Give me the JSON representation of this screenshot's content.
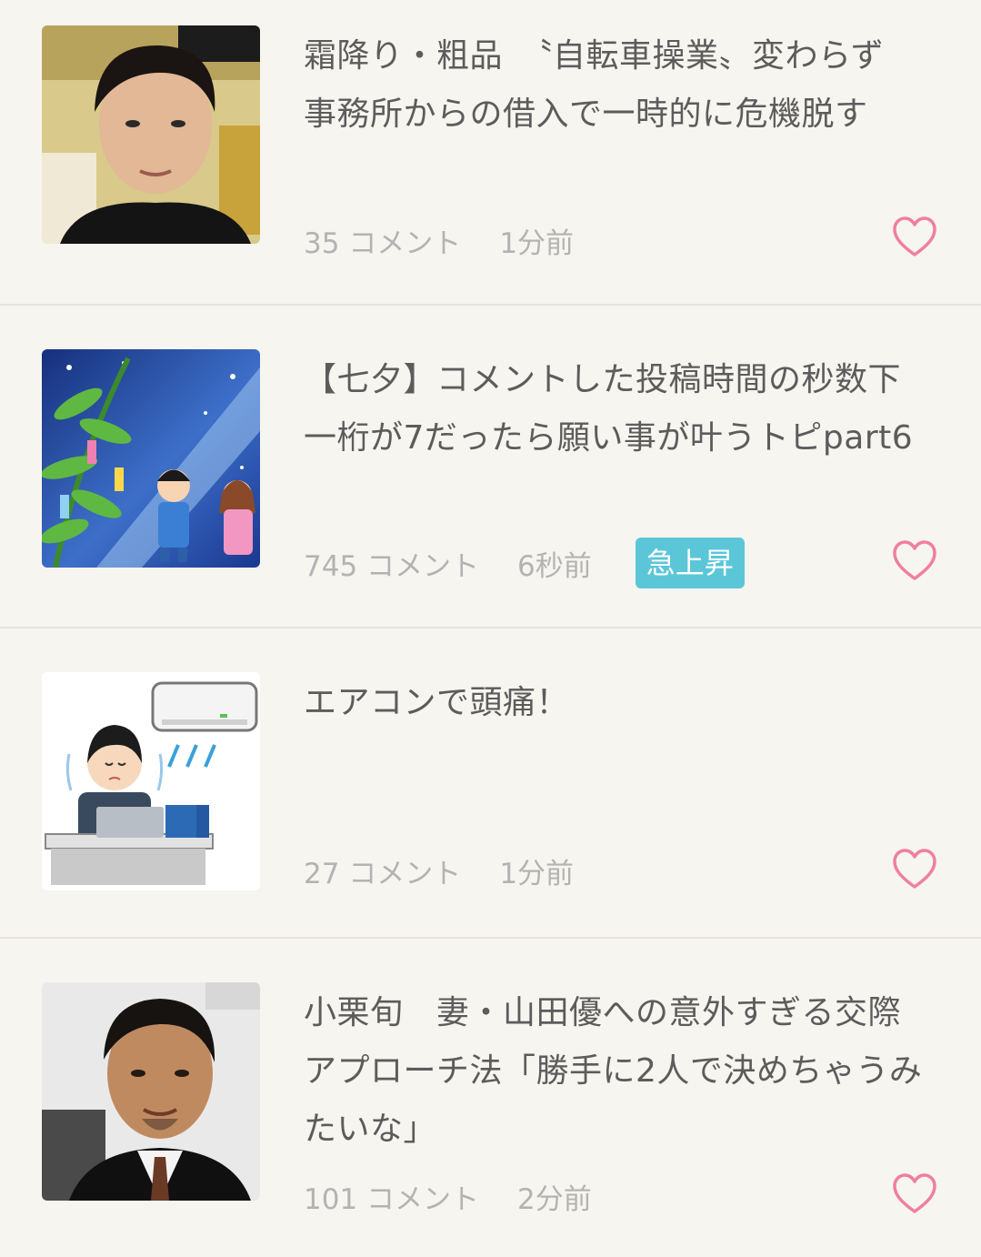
{
  "colors": {
    "background": "#f7f5ef",
    "divider": "#e6e3dc",
    "title_text": "#5c5c5c",
    "meta_text": "#b3b3b3",
    "badge_bg": "#5cc6d9",
    "heart": "#ef7fa0"
  },
  "topics": [
    {
      "title": "霜降り・粗品　〝自転車操業〟変わらず　事務所からの借入で一時的に危機脱す",
      "comments": "35 コメント",
      "time": "1分前",
      "badge": "",
      "thumbnail_icon": "man-photo-thumbnail",
      "favorite_icon": "heart-outline-icon"
    },
    {
      "title": "【七夕】コメントした投稿時間の秒数下一桁が7だったら願い事が叶うトピpart6",
      "comments": "745 コメント",
      "time": "6秒前",
      "badge": "急上昇",
      "thumbnail_icon": "tanabata-illustration-thumbnail",
      "favorite_icon": "heart-outline-icon"
    },
    {
      "title": "エアコンで頭痛！",
      "comments": "27 コメント",
      "time": "1分前",
      "badge": "",
      "thumbnail_icon": "aircon-illustration-thumbnail",
      "favorite_icon": "heart-outline-icon"
    },
    {
      "title": "小栗旬　妻・山田優への意外すぎる交際アプローチ法「勝手に2人で決めちゃうみたいな」",
      "comments": "101 コメント",
      "time": "2分前",
      "badge": "",
      "thumbnail_icon": "man-photo-thumbnail",
      "favorite_icon": "heart-outline-icon"
    }
  ]
}
